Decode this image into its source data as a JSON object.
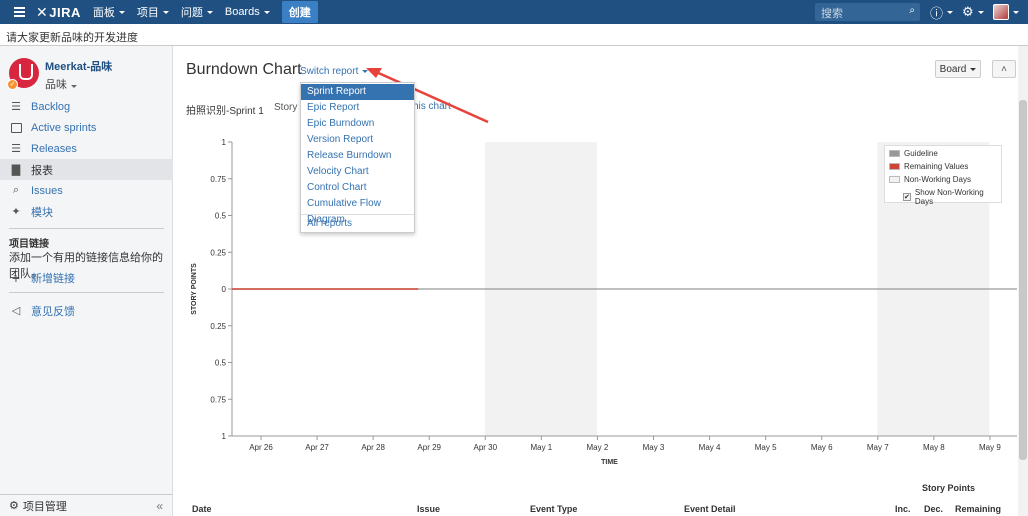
{
  "topnav": {
    "logo_text": "JIRA",
    "items": [
      {
        "label": "面板"
      },
      {
        "label": "项目"
      },
      {
        "label": "问题"
      },
      {
        "label": "Boards"
      }
    ],
    "create_label": "创建",
    "search_placeholder": "搜索",
    "bar_color": "#205081"
  },
  "announcement": "请大家更新品味的开发进度",
  "sidebar": {
    "project_name": "Meerkat-品味",
    "project_type": "品味",
    "items": [
      {
        "label": "Backlog",
        "icon": "backlog-icon"
      },
      {
        "label": "Active sprints",
        "icon": "sprints-icon"
      },
      {
        "label": "Releases",
        "icon": "releases-icon"
      },
      {
        "label": "报表",
        "icon": "reports-icon"
      },
      {
        "label": "Issues",
        "icon": "issues-icon"
      },
      {
        "label": "模块",
        "icon": "components-icon"
      }
    ],
    "links_heading": "项目链接",
    "links_text": "添加一个有用的链接信息给你的团队。",
    "add_link_label": "新增链接",
    "feedback_label": "意见反馈",
    "footer_label": "项目管理"
  },
  "main": {
    "title": "Burndown Chart",
    "switch_report_label": "Switch report",
    "board_label": "Board",
    "sprint_label": "拍照识别-Sprint 1",
    "story_points_label": "Story P",
    "this_chart_label": "his chart"
  },
  "dropdown": {
    "items": [
      {
        "label": "Sprint Report",
        "selected": true
      },
      {
        "label": "Epic Report"
      },
      {
        "label": "Epic Burndown"
      },
      {
        "label": "Version Report"
      },
      {
        "label": "Release Burndown"
      },
      {
        "label": "Velocity Chart"
      },
      {
        "label": "Control Chart"
      },
      {
        "label": "Cumulative Flow Diagram"
      }
    ],
    "all_reports_label": "All reports"
  },
  "chart_data": {
    "type": "line",
    "xlabel": "TIME",
    "ylabel": "STORY POINTS",
    "x": [
      "Apr 26",
      "Apr 27",
      "Apr 28",
      "Apr 29",
      "Apr 30",
      "May 1",
      "May 2",
      "May 3",
      "May 4",
      "May 5",
      "May 6",
      "May 7",
      "May 8",
      "May 9"
    ],
    "ylim": [
      -1,
      1
    ],
    "y_ticks": [
      "1",
      "0.75",
      "0.5",
      "0.25",
      "0",
      "0.25",
      "0.5",
      "0.75",
      "1"
    ],
    "series": [
      {
        "name": "Guideline",
        "color": "#999999",
        "values": [
          0,
          0,
          0,
          0,
          0,
          0,
          0,
          0,
          0,
          0,
          0,
          0,
          0,
          0
        ]
      },
      {
        "name": "Remaining Values",
        "color": "#d04437",
        "values": [
          0,
          0,
          0,
          0
        ]
      }
    ],
    "non_working_days": [
      "Apr 30 – May 1",
      "May 7 – May 8"
    ],
    "legend": {
      "entries": [
        {
          "label": "Guideline",
          "color": "#999999"
        },
        {
          "label": "Remaining Values",
          "color": "#d04437"
        },
        {
          "label": "Non-Working Days",
          "color": "#f2f2f2"
        }
      ],
      "checkbox_label": "Show Non-Working Days",
      "checkbox_checked": true,
      "placement": "top-right"
    },
    "grid": false
  },
  "table": {
    "group_header": "Story Points",
    "columns": [
      "Date",
      "Issue",
      "Event Type",
      "Event Detail",
      "Inc.",
      "Dec.",
      "Remaining"
    ]
  }
}
